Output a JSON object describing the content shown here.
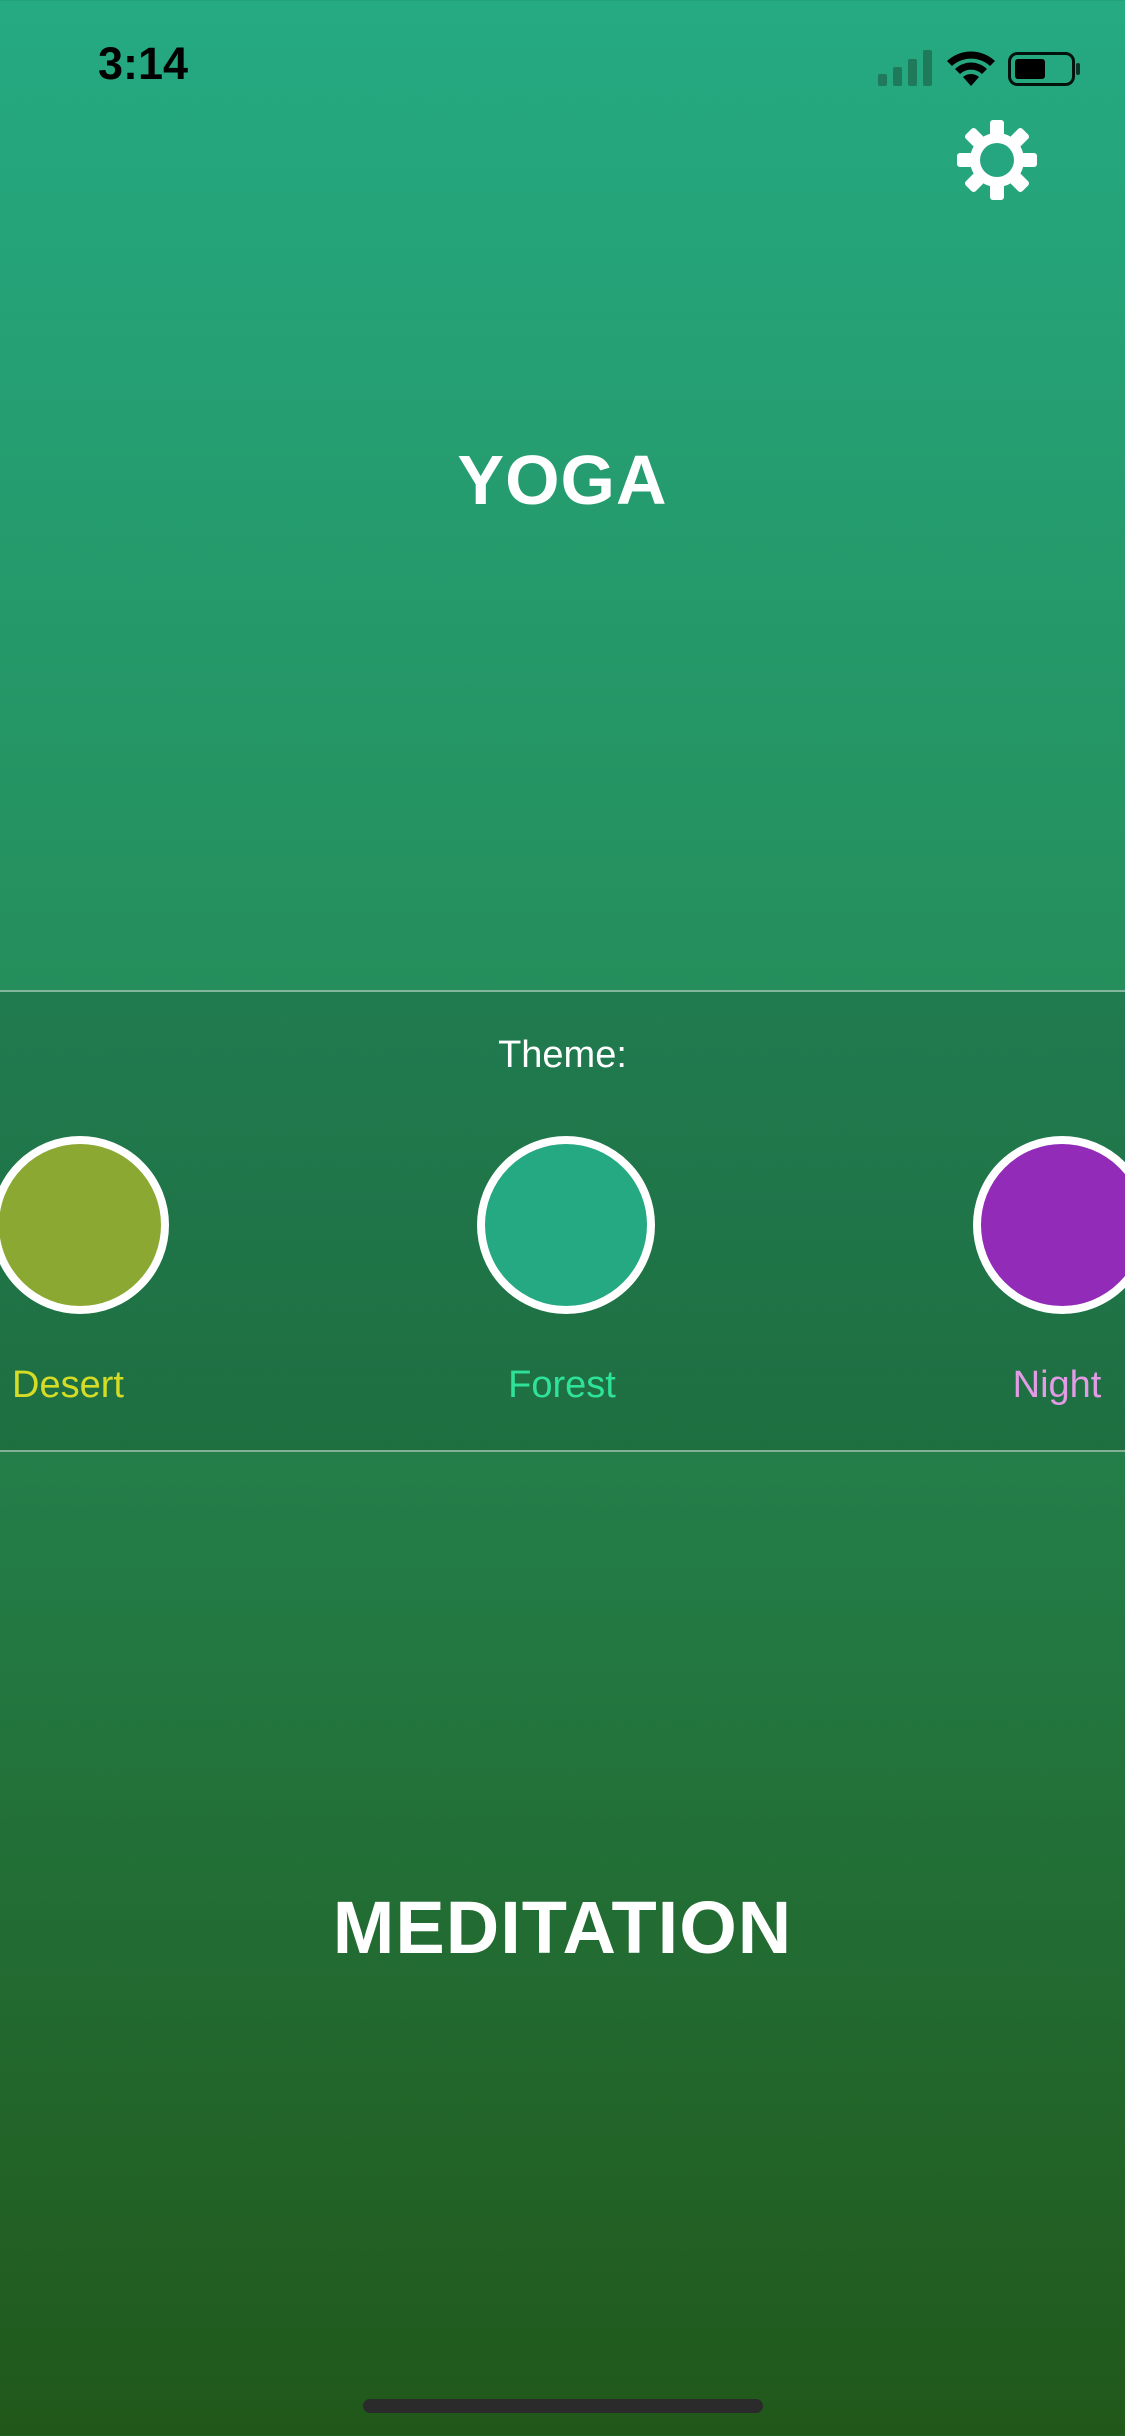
{
  "status_bar": {
    "time": "3:14",
    "icons": [
      "cell-signal-icon",
      "wifi-icon",
      "battery-icon"
    ]
  },
  "settings": {
    "icon": "gear-icon"
  },
  "yoga": {
    "label": "YOGA"
  },
  "theme": {
    "label": "Theme:",
    "options": [
      {
        "label": "Desert",
        "color": "#8aa832",
        "text_color": "#d5dc26"
      },
      {
        "label": "Forest",
        "color": "#25a982",
        "text_color": "#2fe29a",
        "selected": true
      },
      {
        "label": "Night",
        "color": "#912bb8",
        "text_color": "#e39be6"
      }
    ]
  },
  "meditation": {
    "label": "MEDITATION"
  },
  "colors": {
    "background_top": "#25aa82",
    "background_bottom": "#21581a",
    "foreground": "#ffffff"
  }
}
